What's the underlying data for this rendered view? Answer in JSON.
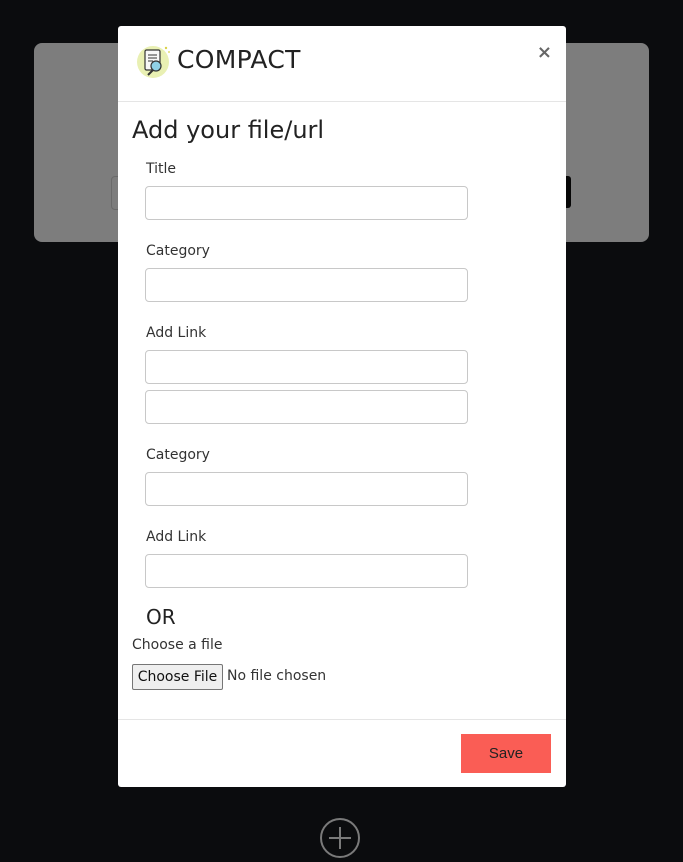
{
  "brand": {
    "name": "COMPACT"
  },
  "modal": {
    "close_label": "×",
    "title": "Add your file/url",
    "fields": {
      "title_label": "Title",
      "category_label": "Category",
      "add_link_label": "Add Link",
      "category2_label": "Category",
      "add_link2_label": "Add Link"
    },
    "or_text": "OR",
    "file": {
      "label": "Choose a file",
      "button_label": "Choose File",
      "status": "No file chosen"
    },
    "save_label": "Save"
  },
  "colors": {
    "accent": "#fa5d55",
    "backdrop": "#0b0c0e"
  }
}
